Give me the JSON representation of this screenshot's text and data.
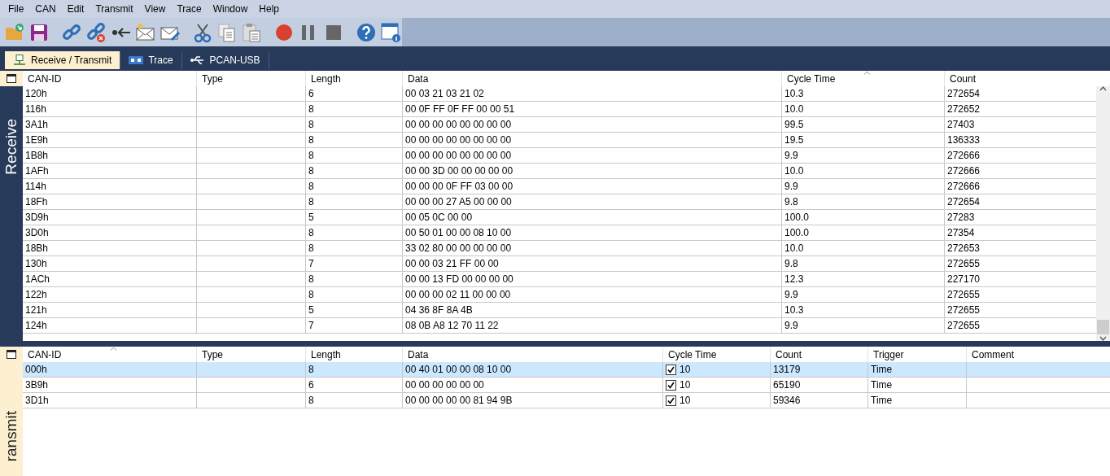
{
  "menu": [
    "File",
    "CAN",
    "Edit",
    "Transmit",
    "View",
    "Trace",
    "Window",
    "Help"
  ],
  "toolbar": [
    {
      "kind": "open"
    },
    {
      "kind": "save"
    },
    {
      "kind": "sep"
    },
    {
      "kind": "connect"
    },
    {
      "kind": "disconnect"
    },
    {
      "kind": "reset"
    },
    {
      "kind": "newmsg"
    },
    {
      "kind": "editmsg"
    },
    {
      "kind": "sep"
    },
    {
      "kind": "cut"
    },
    {
      "kind": "copy"
    },
    {
      "kind": "paste"
    },
    {
      "kind": "sep"
    },
    {
      "kind": "record"
    },
    {
      "kind": "pause"
    },
    {
      "kind": "stop"
    },
    {
      "kind": "sep"
    },
    {
      "kind": "help"
    },
    {
      "kind": "info"
    }
  ],
  "tabs": [
    {
      "label": "Receive / Transmit",
      "kind": "network",
      "selected": true
    },
    {
      "label": "Trace",
      "kind": "trace",
      "selected": false
    },
    {
      "label": "PCAN-USB",
      "kind": "usb",
      "selected": false
    }
  ],
  "receive": {
    "label": "Receive",
    "columns": [
      {
        "label": "CAN-ID",
        "sorted": false
      },
      {
        "label": "Type",
        "sorted": false
      },
      {
        "label": "Length",
        "sorted": false
      },
      {
        "label": "Data",
        "sorted": false
      },
      {
        "label": "Cycle Time",
        "sorted": true
      },
      {
        "label": "Count",
        "sorted": false
      }
    ],
    "rows": [
      [
        "120h",
        "",
        "6",
        "00 03 21 03 21 02",
        "10.3",
        "272654"
      ],
      [
        "116h",
        "",
        "8",
        "00 0F FF 0F FF 00 00 51",
        "10.0",
        "272652"
      ],
      [
        "3A1h",
        "",
        "8",
        "00 00 00 00 00 00 00 00",
        "99.5",
        "27403"
      ],
      [
        "1E9h",
        "",
        "8",
        "00 00 00 00 00 00 00 00",
        "19.5",
        "136333"
      ],
      [
        "1B8h",
        "",
        "8",
        "00 00 00 00 00 00 00 00",
        "9.9",
        "272666"
      ],
      [
        "1AFh",
        "",
        "8",
        "00 00 3D 00 00 00 00 00",
        "10.0",
        "272666"
      ],
      [
        "114h",
        "",
        "8",
        "00 00 00 0F FF 03 00 00",
        "9.9",
        "272666"
      ],
      [
        "18Fh",
        "",
        "8",
        "00 00 00 27 A5 00 00 00",
        "9.8",
        "272654"
      ],
      [
        "3D9h",
        "",
        "5",
        "00 05 0C 00 00",
        "100.0",
        "27283"
      ],
      [
        "3D0h",
        "",
        "8",
        "00 50 01 00 00 08 10 00",
        "100.0",
        "27354"
      ],
      [
        "18Bh",
        "",
        "8",
        "33 02 80 00 00 00 00 00",
        "10.0",
        "272653"
      ],
      [
        "130h",
        "",
        "7",
        "00 00 03 21 FF 00 00",
        "9.8",
        "272655"
      ],
      [
        "1ACh",
        "",
        "8",
        "00 00 13 FD 00 00 00 00",
        "12.3",
        "227170"
      ],
      [
        "122h",
        "",
        "8",
        "00 00 00 02 11 00 00 00",
        "9.9",
        "272655"
      ],
      [
        "121h",
        "",
        "5",
        "04 36 8F 8A 4B",
        "10.3",
        "272655"
      ],
      [
        "124h",
        "",
        "7",
        "08 0B A8 12 70 11 22",
        "9.9",
        "272655"
      ]
    ]
  },
  "transmit": {
    "label": "ransmit",
    "columns": [
      {
        "label": "CAN-ID",
        "sorted": true
      },
      {
        "label": "Type",
        "sorted": false
      },
      {
        "label": "Length",
        "sorted": false
      },
      {
        "label": "Data",
        "sorted": false
      },
      {
        "label": "Cycle Time",
        "sorted": false
      },
      {
        "label": "Count",
        "sorted": false
      },
      {
        "label": "Trigger",
        "sorted": false
      },
      {
        "label": "Comment",
        "sorted": false
      }
    ],
    "rows": [
      {
        "id": "000h",
        "length": "8",
        "data": "00 40 01 00 00 08 10 00",
        "checked": true,
        "cycle": "10",
        "count": "13179",
        "trigger": "Time",
        "selected": true
      },
      {
        "id": "3B9h",
        "length": "6",
        "data": "00 00 00 00 00 00",
        "checked": true,
        "cycle": "10",
        "count": "65190",
        "trigger": "Time",
        "selected": false
      },
      {
        "id": "3D1h",
        "length": "8",
        "data": "00 00 00 00 00 81 94 9B",
        "checked": true,
        "cycle": "10",
        "count": "59346",
        "trigger": "Time",
        "selected": false
      }
    ]
  }
}
